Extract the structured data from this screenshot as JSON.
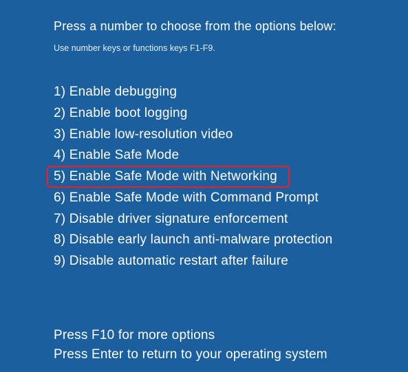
{
  "heading": "Press a number to choose from the options below:",
  "subheading": "Use number keys or functions keys F1-F9.",
  "options": [
    {
      "num": "1)",
      "label": "Enable debugging",
      "highlighted": false
    },
    {
      "num": "2)",
      "label": "Enable boot logging",
      "highlighted": false
    },
    {
      "num": "3)",
      "label": "Enable low-resolution video",
      "highlighted": false
    },
    {
      "num": "4)",
      "label": "Enable Safe Mode",
      "highlighted": false
    },
    {
      "num": "5)",
      "label": "Enable Safe Mode with Networking",
      "highlighted": true
    },
    {
      "num": "6)",
      "label": "Enable Safe Mode with Command Prompt",
      "highlighted": false
    },
    {
      "num": "7)",
      "label": "Disable driver signature enforcement",
      "highlighted": false
    },
    {
      "num": "8)",
      "label": "Disable early launch anti-malware protection",
      "highlighted": false
    },
    {
      "num": "9)",
      "label": "Disable automatic restart after failure",
      "highlighted": false
    }
  ],
  "footer": {
    "line1": "Press F10 for more options",
    "line2": "Press Enter to return to your operating system"
  },
  "colors": {
    "background": "#1b5f9e",
    "text": "#ffffff",
    "highlight_border": "#ff1a1a"
  }
}
